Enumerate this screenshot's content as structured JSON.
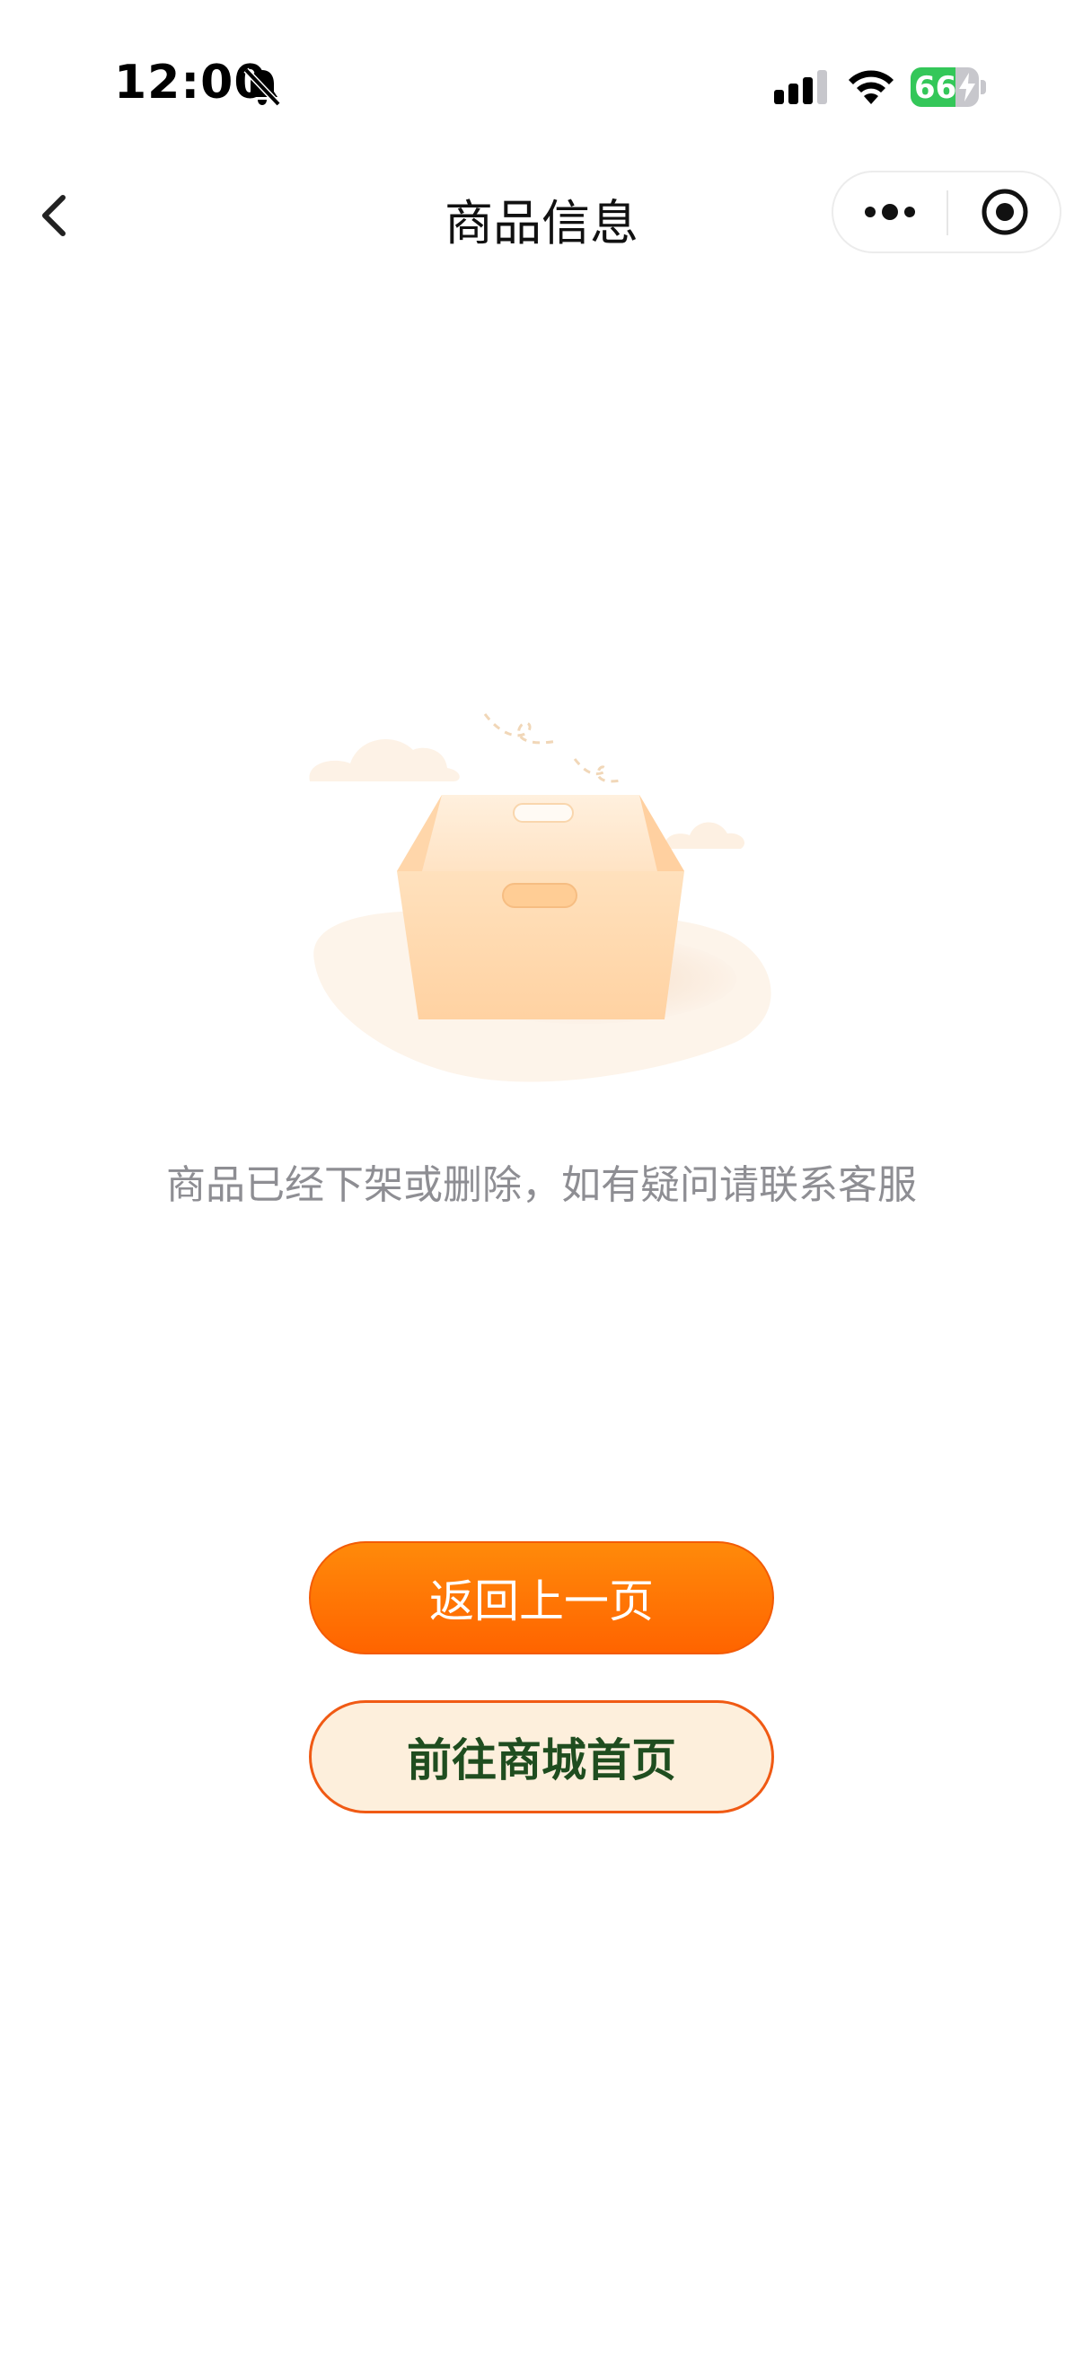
{
  "status_bar": {
    "time": "12:00",
    "battery_percent": "66",
    "battery_level": 0.66,
    "icons": [
      "bell-muted-icon",
      "signal-icon",
      "wifi-icon",
      "battery-icon",
      "charging-bolt-icon"
    ]
  },
  "nav": {
    "title": "商品信息",
    "back_icon": "chevron-left-icon",
    "more_icon": "more-dots-icon",
    "close_icon": "target-close-icon"
  },
  "empty_state": {
    "illustration": "empty-box-illustration",
    "message": "商品已经下架或删除，如有疑问请联系客服"
  },
  "actions": {
    "back_label": "返回上一页",
    "home_label": "前往商城首页"
  },
  "colors": {
    "primary_orange": "#ff7506",
    "home_button_bg": "#fdefdc",
    "home_button_text": "#1f4d1f",
    "message_gray": "#8e8e93",
    "battery_green": "#34c759"
  }
}
